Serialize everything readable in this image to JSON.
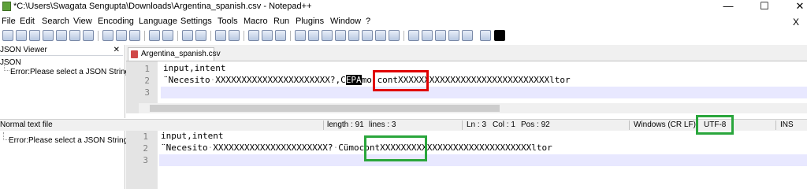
{
  "window": {
    "title": "*C:\\Users\\Swagata Sengupta\\Downloads\\Argentina_spanish.csv - Notepad++",
    "minimize_glyph": "—",
    "maximize_glyph": "☐",
    "close_glyph": "✕",
    "doc_close_glyph": "X"
  },
  "menu": [
    "File",
    "Edit",
    "Search",
    "View",
    "Encoding",
    "Language",
    "Settings",
    "Tools",
    "Macro",
    "Run",
    "Plugins",
    "Window",
    "?"
  ],
  "json_viewer": {
    "title": "JSON Viewer",
    "close_glyph": "✕",
    "root": "JSON",
    "error": "Error:Please select a JSON String."
  },
  "bottom_panel": {
    "error": "Error:Please select a JSON String."
  },
  "tab": {
    "label": "Argentina_spanish.csv"
  },
  "editor_top": {
    "lines": [
      {
        "no": "1",
        "text": "input,intent"
      },
      {
        "no": "2",
        "pre": "¨Necesito",
        "x1": "XXXXXXXXXXXXXXXXXXXXXX?,C",
        "selected": "EPA",
        "mid": "mo",
        "cont": "contXXXXXXXXXXXXXXXXXXXXXXXXXXXXXltor"
      },
      {
        "no": "3",
        "text": ""
      }
    ]
  },
  "status": {
    "type": "Normal text file",
    "length": "length : 91",
    "lines": "lines : 3",
    "ln": "Ln : 3",
    "col": "Col : 1",
    "pos": "Pos : 92",
    "eol": "Windows (CR LF)",
    "encoding": "UTF-8",
    "mode": "INS"
  },
  "editor_bottom": {
    "lines": [
      {
        "no": "1",
        "text": "input,intent"
      },
      {
        "no": "2",
        "pre": "¨Necesito",
        "x1": "XXXXXXXXXXXXXXXXXXXXXX?",
        "rest": "CümocontXXXXXXXXXXXXXXXXXXXXXXXXXXXXXltor"
      },
      {
        "no": "3",
        "text": ""
      }
    ]
  },
  "colors": {
    "annotation_red": "#e00000",
    "annotation_green": "#2aa63c",
    "current_line": "#e8e8ff"
  }
}
